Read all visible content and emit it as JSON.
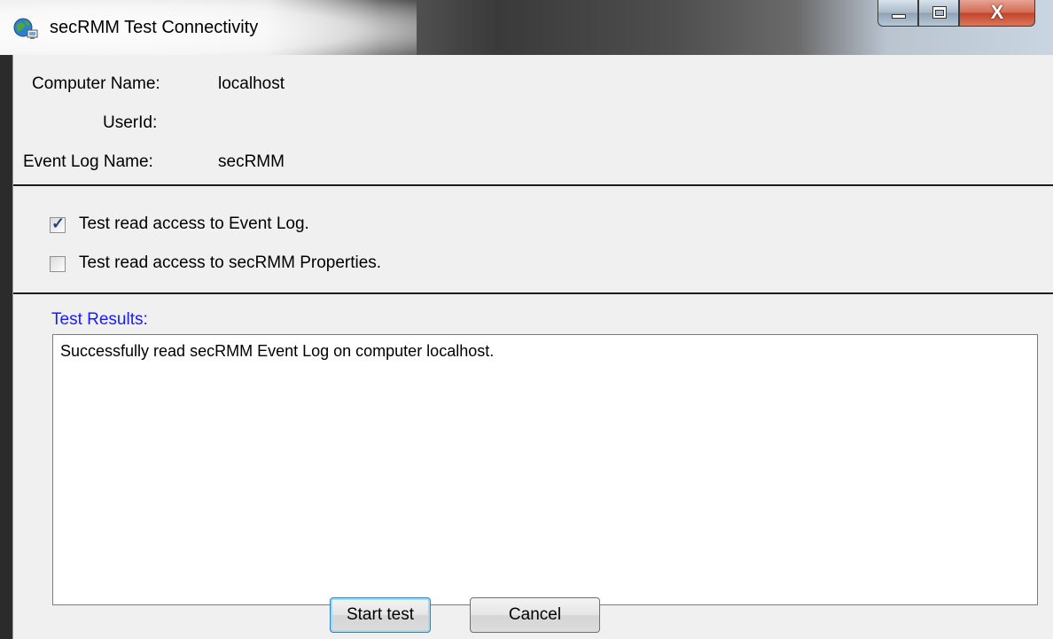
{
  "window": {
    "title": "secRMM Test Connectivity",
    "icons": {
      "app": "globe-network-icon",
      "minimize": "minimize-icon",
      "maximize": "maximize-icon",
      "close": "close-icon"
    },
    "close_glyph": "X"
  },
  "info": {
    "computer_name_label": "Computer Name:",
    "computer_name_value": "localhost",
    "userid_label": "UserId:",
    "userid_value": "",
    "event_log_label": "Event Log Name:",
    "event_log_value": "secRMM"
  },
  "options": {
    "test_event_log": {
      "label": "Test read access to Event Log.",
      "checked": true
    },
    "test_properties": {
      "label": "Test read access to secRMM Properties.",
      "checked": false
    }
  },
  "results": {
    "label": "Test Results:",
    "text": "Successfully read secRMM Event Log on computer localhost.",
    "label_color": "#1a1aff"
  },
  "buttons": {
    "start": "Start test",
    "cancel": "Cancel"
  }
}
